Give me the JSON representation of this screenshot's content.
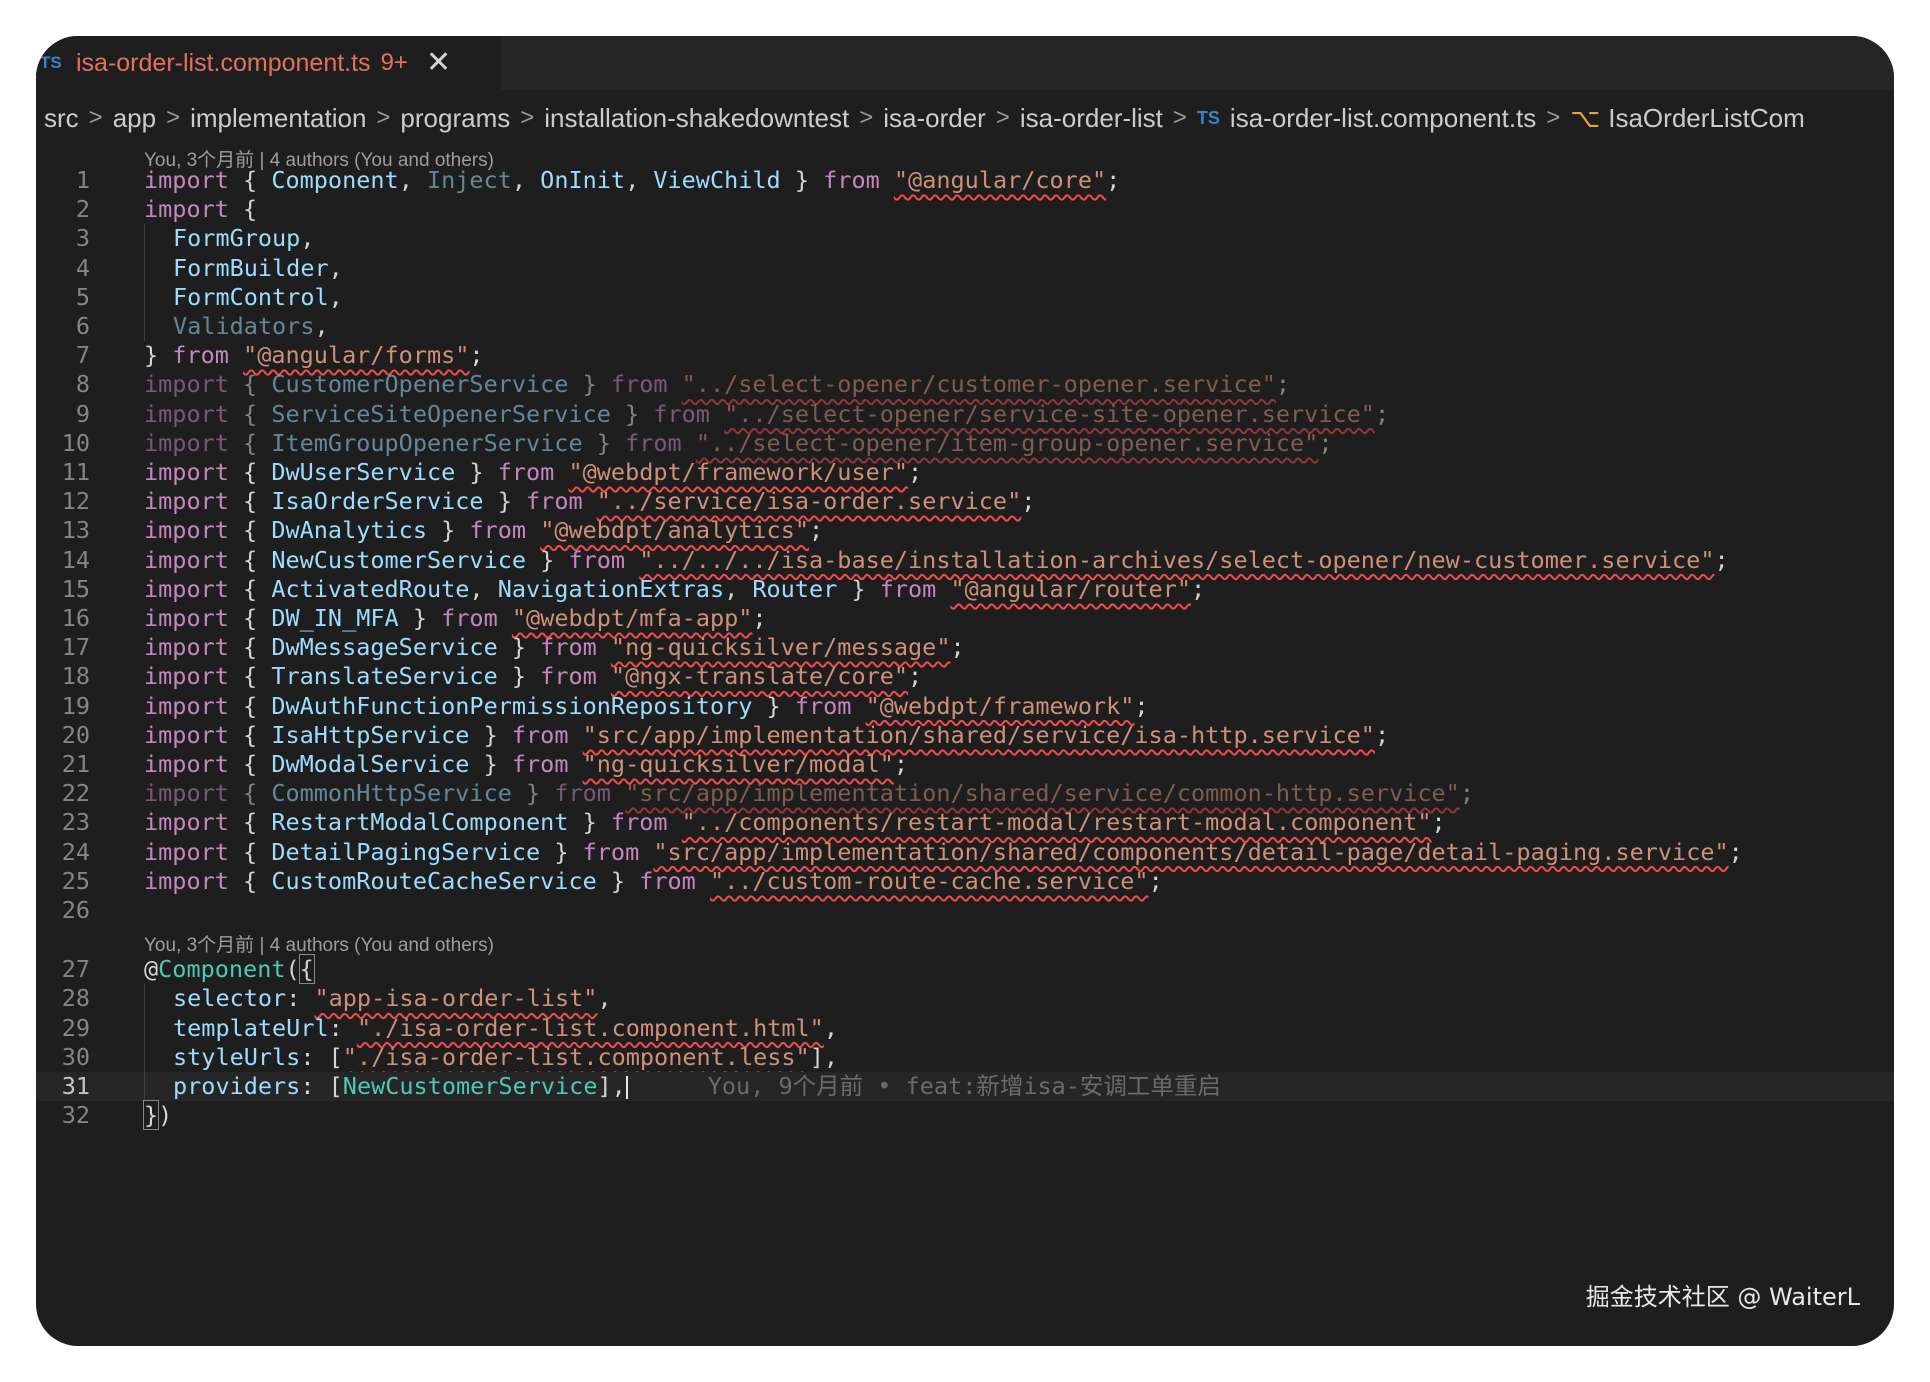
{
  "tab": {
    "badge": "TS",
    "filename": "isa-order-list.component.ts",
    "problems": "9+",
    "close_glyph": "✕"
  },
  "breadcrumb": {
    "items": [
      "src",
      "app",
      "implementation",
      "programs",
      "installation-shakedowntest",
      "isa-order",
      "isa-order-list"
    ],
    "file_badge": "TS",
    "file": "isa-order-list.component.ts",
    "symbol": "IsaOrderListCom",
    "separator": ">"
  },
  "codelens": {
    "top": "You, 3个月前 | 4 authors (You and others)",
    "component": "You, 3个月前 | 4 authors (You and others)"
  },
  "blame": {
    "line31": "You, 9个月前 • feat:新增isa-安调工单重启"
  },
  "watermark": "掘金技术社区 @ WaiterL",
  "colors": {
    "keyword": "#c586c0",
    "identifier": "#9cdcfe",
    "class": "#4ec9b0",
    "string": "#ce9178",
    "error_squiggle": "#f14c4c",
    "tab_text": "#e2725b",
    "editor_bg": "#1e1e1e"
  },
  "lines": [
    {
      "n": "1",
      "tokens": [
        [
          "kw",
          "import"
        ],
        [
          "p",
          " { "
        ],
        [
          "id",
          "Component"
        ],
        [
          "p",
          ", "
        ],
        [
          "id dim",
          "Inject"
        ],
        [
          "p",
          ", "
        ],
        [
          "id",
          "OnInit"
        ],
        [
          "p",
          ", "
        ],
        [
          "id",
          "ViewChild"
        ],
        [
          "p",
          " } "
        ],
        [
          "kw",
          "from"
        ],
        [
          "p",
          " "
        ],
        [
          "str",
          "\"@angular/core\""
        ],
        [
          "p",
          ";"
        ]
      ]
    },
    {
      "n": "2",
      "tokens": [
        [
          "kw",
          "import"
        ],
        [
          "p",
          " {"
        ]
      ]
    },
    {
      "n": "3",
      "indent": true,
      "tokens": [
        [
          "id",
          "FormGroup"
        ],
        [
          "p",
          ","
        ]
      ]
    },
    {
      "n": "4",
      "indent": true,
      "tokens": [
        [
          "id",
          "FormBuilder"
        ],
        [
          "p",
          ","
        ]
      ]
    },
    {
      "n": "5",
      "indent": true,
      "tokens": [
        [
          "id",
          "FormControl"
        ],
        [
          "p",
          ","
        ]
      ]
    },
    {
      "n": "6",
      "indent": true,
      "tokens": [
        [
          "id dim",
          "Validators"
        ],
        [
          "p",
          ","
        ]
      ]
    },
    {
      "n": "7",
      "tokens": [
        [
          "p",
          "} "
        ],
        [
          "kw",
          "from"
        ],
        [
          "p",
          " "
        ],
        [
          "str",
          "\"@angular/forms\""
        ],
        [
          "p",
          ";"
        ]
      ]
    },
    {
      "n": "8",
      "dim": true,
      "tokens": [
        [
          "kw",
          "import"
        ],
        [
          "p",
          " { "
        ],
        [
          "id",
          "CustomerOpenerService"
        ],
        [
          "p",
          " } "
        ],
        [
          "kw",
          "from"
        ],
        [
          "p",
          " "
        ],
        [
          "str",
          "\"../select-opener/customer-opener.service\""
        ],
        [
          "p",
          ";"
        ]
      ]
    },
    {
      "n": "9",
      "dim": true,
      "tokens": [
        [
          "kw",
          "import"
        ],
        [
          "p",
          " { "
        ],
        [
          "id",
          "ServiceSiteOpenerService"
        ],
        [
          "p",
          " } "
        ],
        [
          "kw",
          "from"
        ],
        [
          "p",
          " "
        ],
        [
          "str",
          "\"../select-opener/service-site-opener.service\""
        ],
        [
          "p",
          ";"
        ]
      ]
    },
    {
      "n": "10",
      "dim": true,
      "tokens": [
        [
          "kw",
          "import"
        ],
        [
          "p",
          " { "
        ],
        [
          "id",
          "ItemGroupOpenerService"
        ],
        [
          "p",
          " } "
        ],
        [
          "kw",
          "from"
        ],
        [
          "p",
          " "
        ],
        [
          "str",
          "\"../select-opener/item-group-opener.service\""
        ],
        [
          "p",
          ";"
        ]
      ]
    },
    {
      "n": "11",
      "tokens": [
        [
          "kw",
          "import"
        ],
        [
          "p",
          " { "
        ],
        [
          "id",
          "DwUserService"
        ],
        [
          "p",
          " } "
        ],
        [
          "kw",
          "from"
        ],
        [
          "p",
          " "
        ],
        [
          "str",
          "\"@webdpt/framework/user\""
        ],
        [
          "p",
          ";"
        ]
      ]
    },
    {
      "n": "12",
      "tokens": [
        [
          "kw",
          "import"
        ],
        [
          "p",
          " { "
        ],
        [
          "id",
          "IsaOrderService"
        ],
        [
          "p",
          " } "
        ],
        [
          "kw",
          "from"
        ],
        [
          "p",
          " "
        ],
        [
          "str",
          "\"../service/isa-order.service\""
        ],
        [
          "p",
          ";"
        ]
      ]
    },
    {
      "n": "13",
      "tokens": [
        [
          "kw",
          "import"
        ],
        [
          "p",
          " { "
        ],
        [
          "id",
          "DwAnalytics"
        ],
        [
          "p",
          " } "
        ],
        [
          "kw",
          "from"
        ],
        [
          "p",
          " "
        ],
        [
          "str",
          "\"@webdpt/analytics\""
        ],
        [
          "p",
          ";"
        ]
      ]
    },
    {
      "n": "14",
      "tokens": [
        [
          "kw",
          "import"
        ],
        [
          "p",
          " { "
        ],
        [
          "id",
          "NewCustomerService"
        ],
        [
          "p",
          " } "
        ],
        [
          "kw",
          "from"
        ],
        [
          "p",
          " "
        ],
        [
          "str",
          "\"../../../isa-base/installation-archives/select-opener/new-customer.service\""
        ],
        [
          "p",
          ";"
        ]
      ]
    },
    {
      "n": "15",
      "tokens": [
        [
          "kw",
          "import"
        ],
        [
          "p",
          " { "
        ],
        [
          "id",
          "ActivatedRoute"
        ],
        [
          "p",
          ", "
        ],
        [
          "id",
          "NavigationExtras"
        ],
        [
          "p",
          ", "
        ],
        [
          "id",
          "Router"
        ],
        [
          "p",
          " } "
        ],
        [
          "kw",
          "from"
        ],
        [
          "p",
          " "
        ],
        [
          "str",
          "\"@angular/router\""
        ],
        [
          "p",
          ";"
        ]
      ]
    },
    {
      "n": "16",
      "tokens": [
        [
          "kw",
          "import"
        ],
        [
          "p",
          " { "
        ],
        [
          "id",
          "DW_IN_MFA"
        ],
        [
          "p",
          " } "
        ],
        [
          "kw",
          "from"
        ],
        [
          "p",
          " "
        ],
        [
          "str",
          "\"@webdpt/mfa-app\""
        ],
        [
          "p",
          ";"
        ]
      ]
    },
    {
      "n": "17",
      "tokens": [
        [
          "kw",
          "import"
        ],
        [
          "p",
          " { "
        ],
        [
          "id",
          "DwMessageService"
        ],
        [
          "p",
          " } "
        ],
        [
          "kw",
          "from"
        ],
        [
          "p",
          " "
        ],
        [
          "str",
          "\"ng-quicksilver/message\""
        ],
        [
          "p",
          ";"
        ]
      ]
    },
    {
      "n": "18",
      "tokens": [
        [
          "kw",
          "import"
        ],
        [
          "p",
          " { "
        ],
        [
          "id",
          "TranslateService"
        ],
        [
          "p",
          " } "
        ],
        [
          "kw",
          "from"
        ],
        [
          "p",
          " "
        ],
        [
          "str",
          "\"@ngx-translate/core\""
        ],
        [
          "p",
          ";"
        ]
      ]
    },
    {
      "n": "19",
      "tokens": [
        [
          "kw",
          "import"
        ],
        [
          "p",
          " { "
        ],
        [
          "id",
          "DwAuthFunctionPermissionRepository"
        ],
        [
          "p",
          " } "
        ],
        [
          "kw",
          "from"
        ],
        [
          "p",
          " "
        ],
        [
          "str",
          "\"@webdpt/framework\""
        ],
        [
          "p",
          ";"
        ]
      ]
    },
    {
      "n": "20",
      "tokens": [
        [
          "kw",
          "import"
        ],
        [
          "p",
          " { "
        ],
        [
          "id",
          "IsaHttpService"
        ],
        [
          "p",
          " } "
        ],
        [
          "kw",
          "from"
        ],
        [
          "p",
          " "
        ],
        [
          "str",
          "\"src/app/implementation/shared/service/isa-http.service\""
        ],
        [
          "p",
          ";"
        ]
      ]
    },
    {
      "n": "21",
      "tokens": [
        [
          "kw",
          "import"
        ],
        [
          "p",
          " { "
        ],
        [
          "id",
          "DwModalService"
        ],
        [
          "p",
          " } "
        ],
        [
          "kw",
          "from"
        ],
        [
          "p",
          " "
        ],
        [
          "str",
          "\"ng-quicksilver/modal\""
        ],
        [
          "p",
          ";"
        ]
      ]
    },
    {
      "n": "22",
      "dim": true,
      "tokens": [
        [
          "kw",
          "import"
        ],
        [
          "p",
          " { "
        ],
        [
          "id",
          "CommonHttpService"
        ],
        [
          "p",
          " } "
        ],
        [
          "kw",
          "from"
        ],
        [
          "p",
          " "
        ],
        [
          "str",
          "\"src/app/implementation/shared/service/common-http.service\""
        ],
        [
          "p",
          ";"
        ]
      ]
    },
    {
      "n": "23",
      "tokens": [
        [
          "kw",
          "import"
        ],
        [
          "p",
          " { "
        ],
        [
          "id",
          "RestartModalComponent"
        ],
        [
          "p",
          " } "
        ],
        [
          "kw",
          "from"
        ],
        [
          "p",
          " "
        ],
        [
          "str",
          "\"../components/restart-modal/restart-modal.component\""
        ],
        [
          "p",
          ";"
        ]
      ]
    },
    {
      "n": "24",
      "tokens": [
        [
          "kw",
          "import"
        ],
        [
          "p",
          " { "
        ],
        [
          "id",
          "DetailPagingService"
        ],
        [
          "p",
          " } "
        ],
        [
          "kw",
          "from"
        ],
        [
          "p",
          " "
        ],
        [
          "str",
          "\"src/app/implementation/shared/components/detail-page/detail-paging.service\""
        ],
        [
          "p",
          ";"
        ]
      ]
    },
    {
      "n": "25",
      "tokens": [
        [
          "kw",
          "import"
        ],
        [
          "p",
          " { "
        ],
        [
          "id",
          "CustomRouteCacheService"
        ],
        [
          "p",
          " } "
        ],
        [
          "kw",
          "from"
        ],
        [
          "p",
          " "
        ],
        [
          "str",
          "\"../custom-route-cache.service\""
        ],
        [
          "p",
          ";"
        ]
      ]
    },
    {
      "n": "26",
      "tokens": []
    },
    {
      "n": "27",
      "tokens": [
        [
          "p",
          "@"
        ],
        [
          "cls",
          "Component"
        ],
        [
          "p",
          "("
        ],
        [
          "bracket",
          "{"
        ]
      ]
    },
    {
      "n": "28",
      "indent": true,
      "tokens": [
        [
          "id",
          "selector"
        ],
        [
          "p",
          ": "
        ],
        [
          "str",
          "\"app-isa-order-list\""
        ],
        [
          "p",
          ","
        ]
      ]
    },
    {
      "n": "29",
      "indent": true,
      "tokens": [
        [
          "id",
          "templateUrl"
        ],
        [
          "p",
          ": "
        ],
        [
          "str",
          "\"./isa-order-list.component.html\""
        ],
        [
          "p",
          ","
        ]
      ]
    },
    {
      "n": "30",
      "indent": true,
      "tokens": [
        [
          "id",
          "styleUrls"
        ],
        [
          "p",
          ": ["
        ],
        [
          "str",
          "\"./isa-order-list.component.less\""
        ],
        [
          "p",
          "],"
        ]
      ]
    },
    {
      "n": "31",
      "indent": true,
      "current": true,
      "tokens": [
        [
          "id",
          "providers"
        ],
        [
          "p",
          ": ["
        ],
        [
          "cls",
          "NewCustomerService"
        ],
        [
          "p",
          "],"
        ]
      ]
    },
    {
      "n": "32",
      "tokens": [
        [
          "bracket",
          "}"
        ],
        [
          "p",
          ")"
        ]
      ]
    }
  ]
}
